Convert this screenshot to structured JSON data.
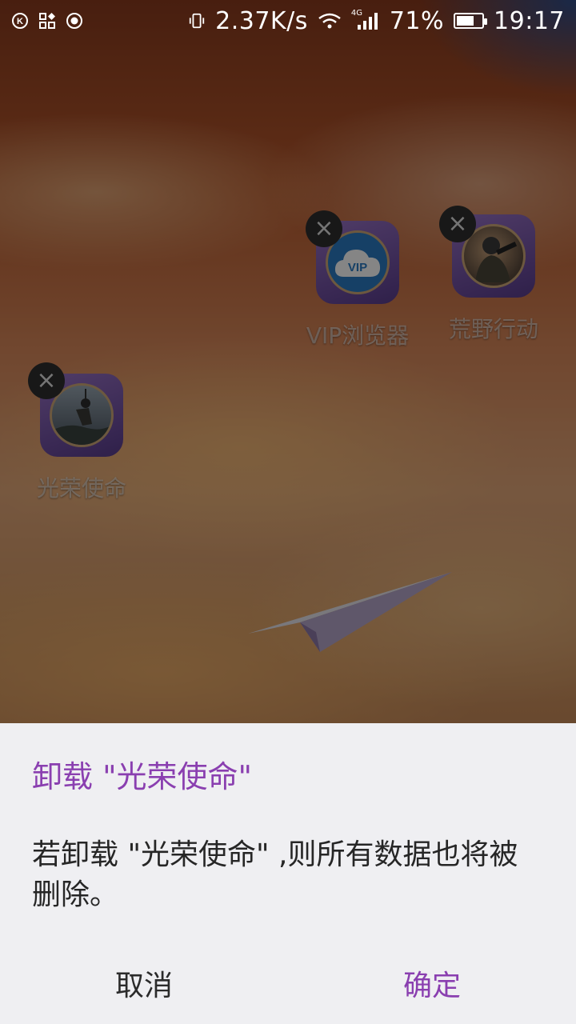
{
  "status_bar": {
    "net_speed": "2.37K/s",
    "network_type": "4G",
    "battery_percent": "71%",
    "battery_level": 0.71,
    "time": "19:17",
    "left_icons": [
      "k-icon",
      "app-grid-icon",
      "record-icon"
    ],
    "right_icons": [
      "vibrate-icon",
      "wifi-icon",
      "signal-icon",
      "battery-icon"
    ]
  },
  "home": {
    "apps": [
      {
        "label": "VIP浏览器",
        "badge": "VIP",
        "icon": "vip-browser-icon"
      },
      {
        "label": "荒野行动",
        "icon": "knives-out-icon"
      },
      {
        "label": "光荣使命",
        "icon": "glorious-mission-icon"
      }
    ],
    "close_glyph": "×"
  },
  "dialog": {
    "title": "卸载 \"光荣使命\"",
    "message": "若卸载 \"光荣使命\" ,则所有数据也将被删除。",
    "cancel_label": "取消",
    "confirm_label": "确定",
    "accent_color": "#8a3fb0"
  }
}
